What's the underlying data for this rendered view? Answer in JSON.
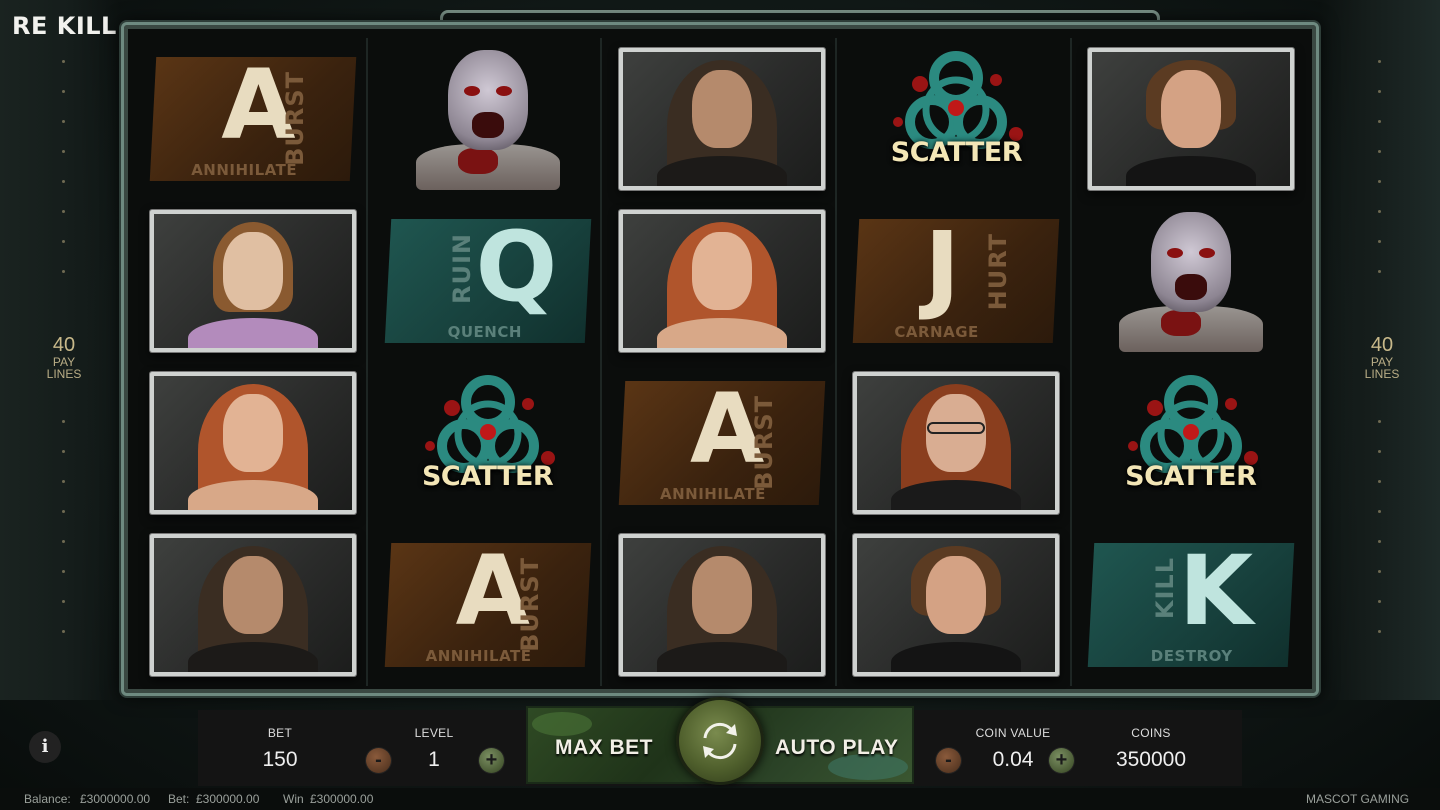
{
  "game": {
    "logo": "RE KILL",
    "paylines_count": "40",
    "paylines_label_line1": "PAY",
    "paylines_label_line2": "LINES"
  },
  "reels": [
    [
      {
        "type": "letter",
        "letter": "A",
        "vertical": "BURST",
        "under": "ANNIHILATE",
        "color": "orange"
      },
      {
        "type": "photo",
        "character": "girl"
      },
      {
        "type": "photo",
        "character": "red-haired-woman"
      },
      {
        "type": "photo",
        "character": "bearded-man"
      }
    ],
    [
      {
        "type": "zombie"
      },
      {
        "type": "letter",
        "letter": "Q",
        "vertical": "RUIN",
        "under": "QUENCH",
        "color": "teal"
      },
      {
        "type": "scatter",
        "label": "SCATTER"
      },
      {
        "type": "letter",
        "letter": "A",
        "vertical": "BURST",
        "under": "ANNIHILATE",
        "color": "orange"
      }
    ],
    [
      {
        "type": "photo",
        "character": "bearded-man"
      },
      {
        "type": "photo",
        "character": "red-haired-woman"
      },
      {
        "type": "letter",
        "letter": "A",
        "vertical": "BURST",
        "under": "ANNIHILATE",
        "color": "orange"
      },
      {
        "type": "photo",
        "character": "bearded-man"
      }
    ],
    [
      {
        "type": "scatter",
        "label": "SCATTER"
      },
      {
        "type": "letter",
        "letter": "J",
        "vertical": "HURT",
        "under": "CARNAGE",
        "color": "orange"
      },
      {
        "type": "photo",
        "character": "woman-with-glasses"
      },
      {
        "type": "photo",
        "character": "young-man"
      }
    ],
    [
      {
        "type": "photo",
        "character": "young-man"
      },
      {
        "type": "zombie"
      },
      {
        "type": "scatter",
        "label": "SCATTER"
      },
      {
        "type": "letter",
        "letter": "K",
        "vertical": "KILL",
        "under": "DESTROY",
        "color": "teal"
      }
    ]
  ],
  "controls": {
    "bet_label": "BET",
    "bet_value": "150",
    "level_label": "LEVEL",
    "level_value": "1",
    "max_bet_label": "MAX BET",
    "auto_play_label": "AUTO PLAY",
    "coin_value_label": "COIN VALUE",
    "coin_value": "0.04",
    "coins_label": "COINS",
    "coins_value": "350000",
    "minus_glyph": "-",
    "plus_glyph": "+",
    "info_glyph": "i"
  },
  "footer": {
    "balance_label": "Balance:",
    "balance_value": "£3000000.00",
    "bet_label": "Bet:",
    "bet_value": "£300000.00",
    "win_label": "Win",
    "win_value": "£300000.00",
    "brand": "MASCOT GAMING"
  },
  "colors": {
    "orange_symbol": "#5a3515",
    "teal_symbol": "#1f5650",
    "scatter_text": "#f3e6b6",
    "biohazard": "#2b8a80",
    "blood": "#9a1414"
  }
}
